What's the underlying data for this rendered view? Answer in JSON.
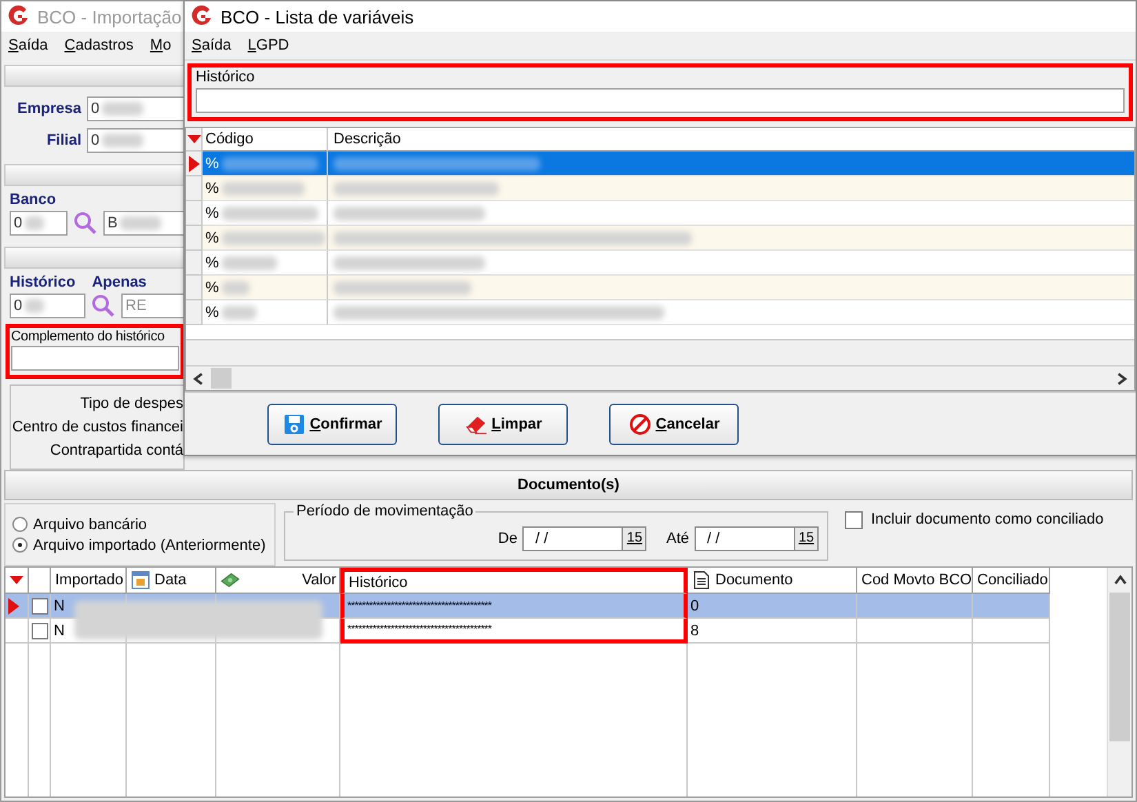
{
  "main_window": {
    "title": "BCO - Importação",
    "menu": [
      "Saída",
      "Cadastros",
      "Mo"
    ],
    "empresa": {
      "label": "Empresa",
      "value": "0"
    },
    "filial": {
      "label": "Filial",
      "value": "0"
    },
    "banco": {
      "label": "Banco",
      "code": "0",
      "name": "B"
    },
    "historico": {
      "label": "Histórico",
      "code": "0"
    },
    "apenas": {
      "label": "Apenas",
      "value": "RE",
      "disabled": true
    },
    "complemento": {
      "label": "Complemento do histórico",
      "highlighted": true
    },
    "group_labels": [
      "Tipo de despes",
      "Centro de custos financei",
      "Contrapartida contá"
    ],
    "documents": {
      "title": "Documento(s)",
      "source_options": [
        {
          "label": "Arquivo bancário",
          "selected": false
        },
        {
          "label": "Arquivo importado (Anteriormente)",
          "selected": true
        }
      ],
      "period": {
        "legend": "Período de movimentação",
        "from_label": "De",
        "from_value": "/ /",
        "to_label": "Até",
        "to_value": "/ /",
        "from_button": "15",
        "to_button": "15"
      },
      "include_conciliated": {
        "label": "Incluir documento como conciliado",
        "checked": false
      },
      "table": {
        "columns": [
          {
            "label": "Importado",
            "highlighted": false
          },
          {
            "label": "Data",
            "highlighted": false
          },
          {
            "label": "Valor",
            "highlighted": false
          },
          {
            "label": "Histórico",
            "highlighted": true
          },
          {
            "label": "Documento",
            "highlighted": false
          },
          {
            "label": "Cod Movto BCO",
            "highlighted": false
          },
          {
            "label": "Conciliado",
            "highlighted": false
          }
        ],
        "rows": [
          {
            "selected": true,
            "checked": false,
            "importado": "N",
            "historico": "****************************************",
            "documento": "0"
          },
          {
            "selected": false,
            "checked": false,
            "importado": "N",
            "historico": "****************************************",
            "documento": "8"
          }
        ]
      }
    }
  },
  "dialog": {
    "title": "BCO - Lista de variáveis",
    "menu": [
      "Saída",
      "LGPD"
    ],
    "filter": {
      "label": "Histórico",
      "highlighted": true
    },
    "columns": [
      "Código",
      "Descrição"
    ],
    "rows": [
      {
        "code": "%",
        "selected": true
      },
      {
        "code": "%",
        "selected": false
      },
      {
        "code": "%",
        "selected": false
      },
      {
        "code": "%",
        "selected": false
      },
      {
        "code": "%",
        "selected": false
      },
      {
        "code": "%",
        "selected": false
      },
      {
        "code": "%",
        "selected": false
      }
    ],
    "buttons": [
      {
        "kind": "confirm",
        "label": "Confirmar"
      },
      {
        "kind": "clear",
        "label": "Limpar"
      },
      {
        "kind": "cancel",
        "label": "Cancelar"
      }
    ]
  }
}
